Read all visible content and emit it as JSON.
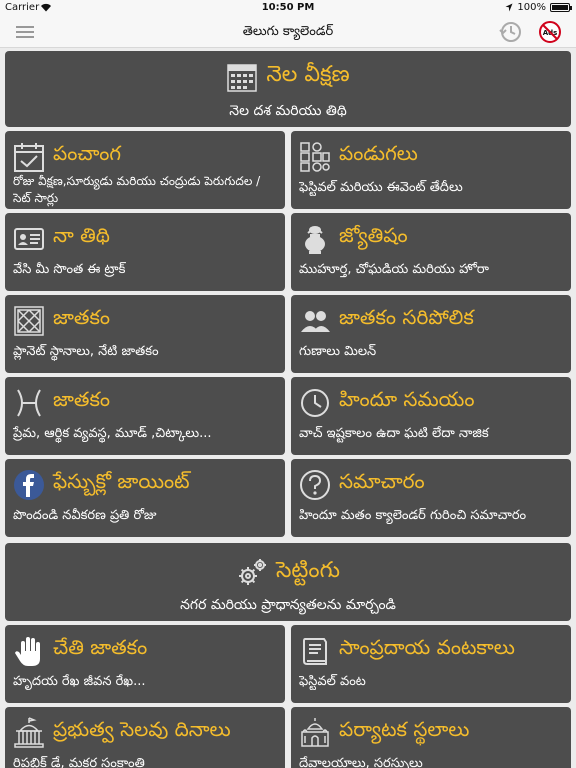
{
  "status_bar": {
    "carrier": "Carrier",
    "time": "10:50 PM",
    "battery": "100%"
  },
  "nav": {
    "title": "తెలుగు క్యాలెండర్"
  },
  "tiles": {
    "month_view": {
      "title": "నెల వీక్షణ",
      "subtitle": "నెల దశ మరియు తిథి",
      "icon": "calendar-grid-icon"
    },
    "panchangam": {
      "title": "పంచాంగ",
      "subtitle": "రోజు వీక్షణ,సూర్యుడు మరియు చంద్రుడు పెరుగుదల / సెట్ సార్లు",
      "icon": "calendar-check-icon"
    },
    "festivals": {
      "title": "పండుగలు",
      "subtitle": "ఫెస్టివల్ మరియు ఈవెంట్ తేదీలు",
      "icon": "festival-grid-icon"
    },
    "my_tithi": {
      "title": "నా తిథి",
      "subtitle": "వేసి మీ సొంత ఈ ట్రాక్",
      "icon": "id-card-icon"
    },
    "jyothisham": {
      "title": "జ్యోతిషం",
      "subtitle": "ముహూర్త, చోఘడియ మరియు హోరా",
      "icon": "kalash-icon"
    },
    "jathakam": {
      "title": "జాతకం",
      "subtitle": "ప్లానెట్ స్థానాలు, నేటి జాతకం",
      "icon": "horoscope-chart-icon"
    },
    "jathakam_match": {
      "title": "జాతకం సరిపోలిక",
      "subtitle": "గుణాలు మిలన్",
      "icon": "couple-icon"
    },
    "rashi_jathakam": {
      "title": "జాతకం",
      "subtitle": "ప్రేమ, ఆర్థిక వ్యవస్థ, మూడ్ ,చిట్కాలు...",
      "icon": "pisces-icon"
    },
    "hindu_time": {
      "title": "హిందూ సమయం",
      "subtitle": "వాచ్ ఇష్టకాలం ఉదా ఘటి లేదా నాజిక",
      "icon": "clock-icon"
    },
    "facebook": {
      "title": "ఫేస్బుక్లో జాయింట్",
      "subtitle": "పొందండి నవీకరణ ప్రతి రోజు",
      "icon": "facebook-icon"
    },
    "news": {
      "title": "సమాచారం",
      "subtitle": "హిందూ మతం క్యాలెండర్ గురించి సమాచారం",
      "icon": "question-icon"
    },
    "settings": {
      "title": "సెట్టింగు",
      "subtitle": "నగర మరియు ప్రాధాన్యతలను మార్చండి",
      "icon": "gears-icon"
    },
    "palmistry": {
      "title": "చేతి జాతకం",
      "subtitle": "హృదయ రేఖ జీవన రేఖ...",
      "icon": "hand-icon"
    },
    "recipes": {
      "title": "సాంప్రదాయ వంటకాలు",
      "subtitle": "ఫెస్టివల్ వంట",
      "icon": "recipe-book-icon"
    },
    "holidays": {
      "title": "ప్రభుత్వ సెలవు దినాలు",
      "subtitle": "రిపబ్లిక్ డే, మకర సంక్రాంతి",
      "icon": "government-building-icon"
    },
    "tourism": {
      "title": "పర్యాటక స్థలాలు",
      "subtitle": "దేవాలయాలు, సరస్సులు",
      "icon": "temple-icon"
    }
  },
  "colors": {
    "accent": "#f5bd2c",
    "tile_bg": "#4d4d4d",
    "page_bg": "#ececec",
    "facebook": "#3b5998",
    "noads_red": "#d0021b"
  }
}
